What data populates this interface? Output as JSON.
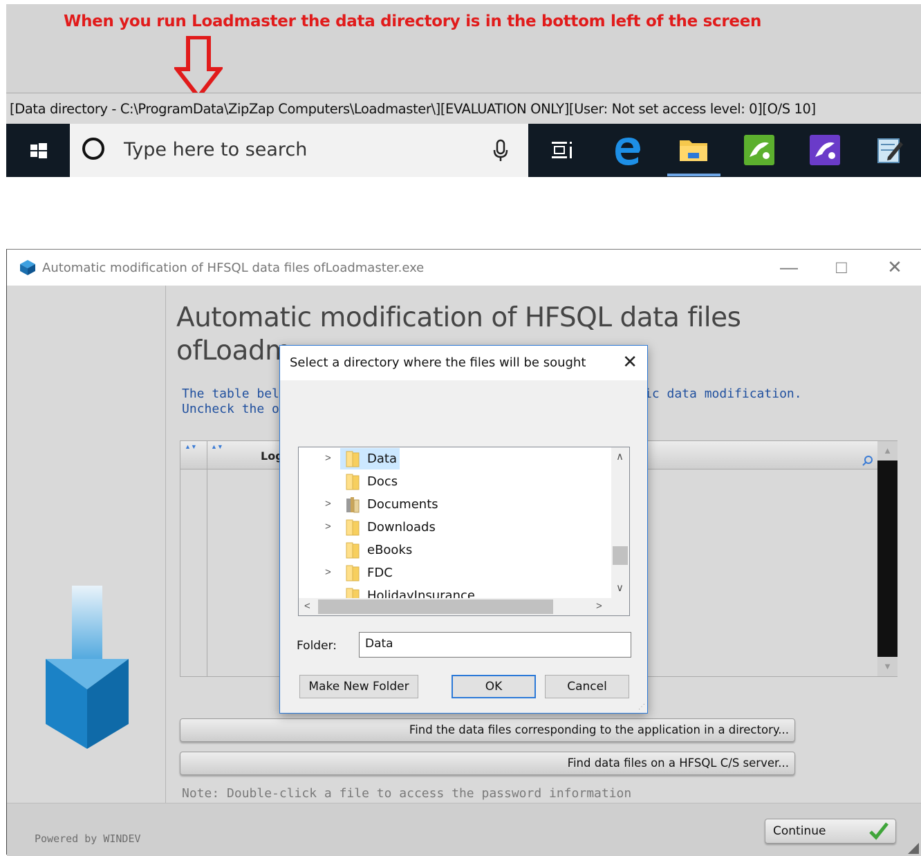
{
  "annotation": {
    "text": "When you run Loadmaster the data directory is in the bottom left of the screen",
    "color": "#e11b1b"
  },
  "status_bar": {
    "text": "[Data directory - C:\\ProgramData\\ZipZap Computers\\Loadmaster\\][EVALUATION ONLY][User: Not set access level: 0][O/S  10]"
  },
  "taskbar": {
    "search_placeholder": "Type here to search",
    "icons": [
      "windows-start-icon",
      "cortana-icon",
      "microphone-icon",
      "task-view-icon",
      "edge-icon",
      "file-explorer-icon",
      "app-green-icon",
      "app-purple-icon",
      "notepad-pen-icon"
    ]
  },
  "app_window": {
    "title": "Automatic modification of HFSQL data files ofLoadmaster.exe",
    "heading_line1": "Automatic modification of HFSQL data files",
    "heading_line2": "ofLoadm",
    "desc_line1_a": "The table below",
    "desc_line1_b": "ic data modification.",
    "desc_line2": "Uncheck the or",
    "grid_col_label": "Log",
    "find_in_dir_button": "Find the data files corresponding to the application in a directory...",
    "find_on_server_button": "Find data files on a HFSQL C/S server...",
    "note": "Note: Double-click a file to access the password information",
    "powered_by": "Powered by WINDEV",
    "continue_button": "Continue"
  },
  "dialog": {
    "title": "Select a directory where the files will be sought",
    "tree": [
      {
        "label": "Data",
        "expandable": true,
        "selected": true,
        "icon": "folder-icon"
      },
      {
        "label": "Docs",
        "expandable": false,
        "selected": false,
        "icon": "folder-icon"
      },
      {
        "label": "Documents",
        "expandable": true,
        "selected": false,
        "icon": "documents-library-icon"
      },
      {
        "label": "Downloads",
        "expandable": true,
        "selected": false,
        "icon": "folder-icon"
      },
      {
        "label": "eBooks",
        "expandable": false,
        "selected": false,
        "icon": "folder-icon"
      },
      {
        "label": "FDC",
        "expandable": true,
        "selected": false,
        "icon": "folder-icon"
      },
      {
        "label": "HolidayInsurance",
        "expandable": false,
        "selected": false,
        "icon": "folder-icon"
      }
    ],
    "folder_label": "Folder:",
    "folder_value": "Data",
    "make_new_folder_button": "Make New Folder",
    "ok_button": "OK",
    "cancel_button": "Cancel"
  }
}
